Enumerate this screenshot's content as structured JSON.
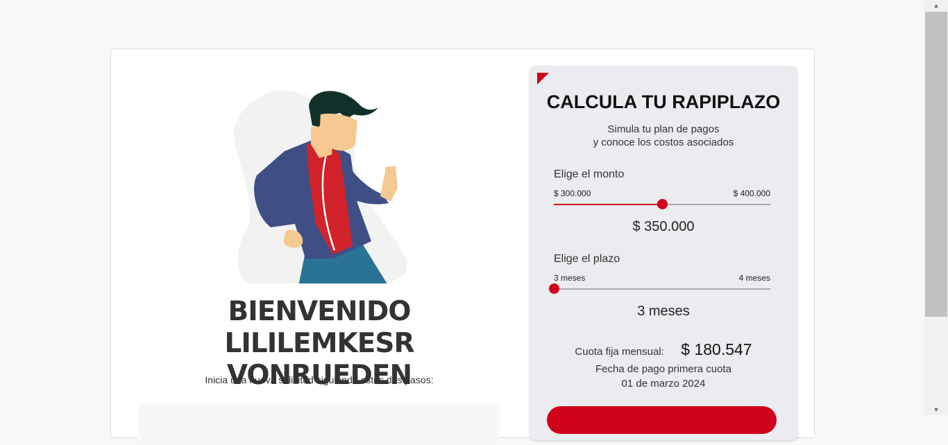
{
  "welcome": {
    "line1": "BIENVENIDO LILILEMKESR",
    "line2": "VONRUEDEN",
    "intro": "Inicia una nueva solicitud siguiendo estos dos pasos:"
  },
  "simulator": {
    "title": "CALCULA TU RAPIPLAZO",
    "subtitle_line1": "Simula tu plan de pagos",
    "subtitle_line2": "y conoce los costos asociados",
    "amount": {
      "label": "Elige el monto",
      "min_label": "$ 300.000",
      "max_label": "$ 400.000",
      "value": "$ 350.000",
      "level": 0.5
    },
    "term": {
      "label": "Elige el plazo",
      "min_label": "3 meses",
      "max_label": "4 meses",
      "value": "3 meses",
      "level": 0
    },
    "cuota_label": "Cuota fija mensual:",
    "cuota_value": "$ 180.547",
    "fecha_label": "Fecha de pago primera cuota",
    "fecha_value": "01 de marzo 2024"
  },
  "colors": {
    "accent": "#d0021b",
    "panel": "#ebecef"
  },
  "icons": {
    "scroll_up": "▲",
    "scroll_down": "▼"
  }
}
